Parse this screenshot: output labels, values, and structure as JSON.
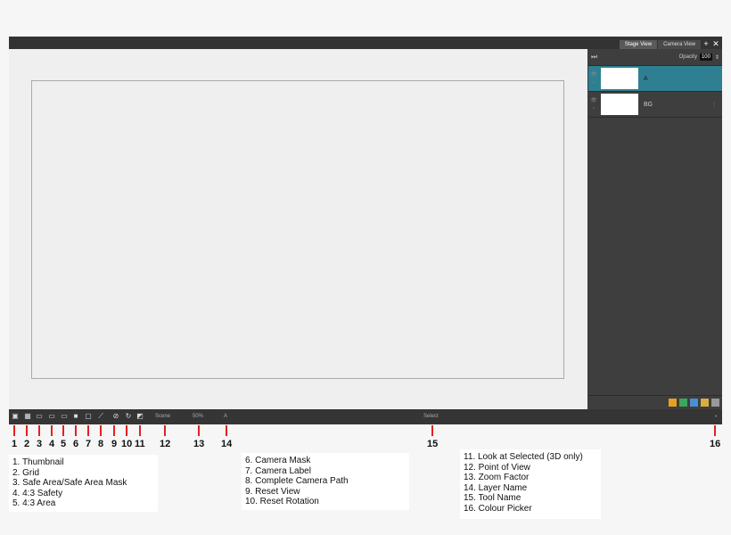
{
  "tabs": {
    "stage": "Stage View",
    "camera": "Camera View",
    "add": "+",
    "close": "✕"
  },
  "panel": {
    "forward_icon": "⏭",
    "opacity_label": "Opacity",
    "opacity_value": "100",
    "spinner": "⇕",
    "layers": [
      {
        "name": "A",
        "selected": true
      },
      {
        "name": "BG",
        "selected": false
      }
    ]
  },
  "statusbar": {
    "point_of_view": "Scene",
    "zoom": "50%",
    "layer_name": "A",
    "tool_name": "Select"
  },
  "numbers": [
    "1",
    "2",
    "3",
    "4",
    "5",
    "6",
    "7",
    "8",
    "9",
    "10",
    "11",
    "12",
    "13",
    "14",
    "15",
    "16"
  ],
  "legend_left": [
    "1.  Thumbnail",
    "2.  Grid",
    "3.  Safe Area/Safe Area Mask",
    "4.  4:3 Safety",
    "5.  4:3 Area"
  ],
  "legend_mid": [
    "6.  Camera Mask",
    "7.  Camera Label",
    "8.  Complete Camera Path",
    "9.  Reset View",
    "10.  Reset Rotation"
  ],
  "legend_right": [
    "11.  Look at Selected (3D only)",
    "12.  Point of View",
    "13.  Zoom Factor",
    "14.  Layer Name",
    "15.  Tool Name",
    "16.  Colour Picker"
  ],
  "colors": {
    "selected_layer": "#2f7f92",
    "marker": "#e32020"
  }
}
